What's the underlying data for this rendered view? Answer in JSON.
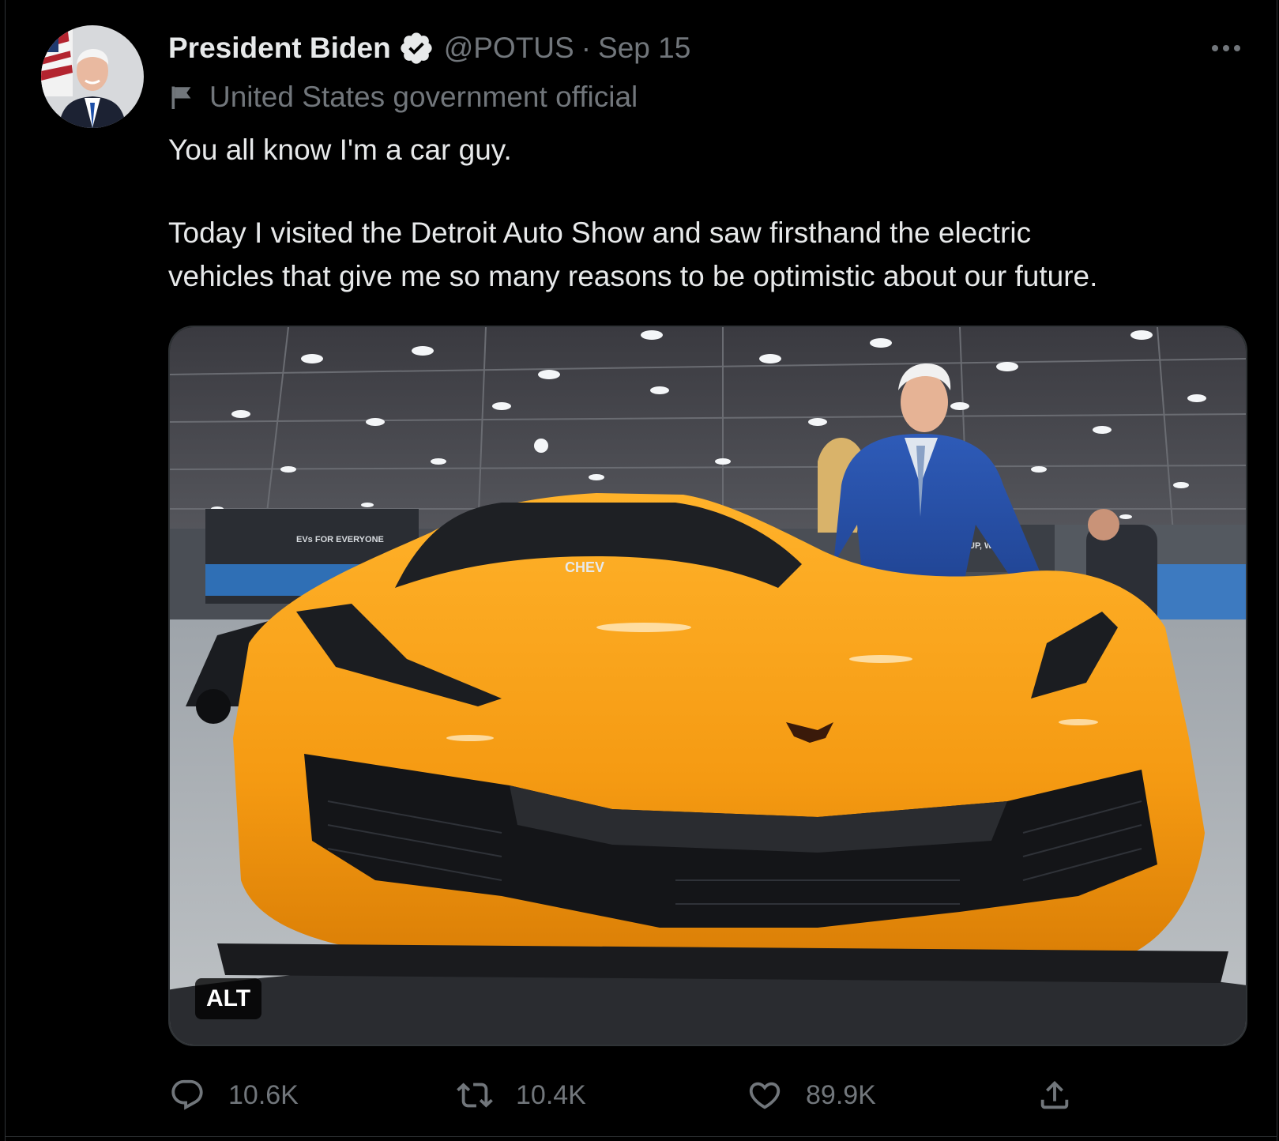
{
  "tweet": {
    "author": {
      "display_name": "President Biden",
      "handle": "@POTUS",
      "verified": true,
      "avatar_icon": "avatar-photo"
    },
    "separator": "·",
    "date": "Sep 15",
    "label": "United States government official",
    "text": {
      "line1": "You all know I'm a car guy.",
      "line2": "Today I visited the Detroit Auto Show and saw firsthand the electric",
      "line3": "vehicles that give me so many reasons to be optimistic about our future."
    },
    "media": {
      "alt_badge": "ALT",
      "booth_sign": "EVs FOR EVERYONE",
      "car_badge": "CHEV",
      "side_sign": "N UP, WORLD"
    },
    "stats": {
      "replies": "10.6K",
      "retweets": "10.4K",
      "likes": "89.9K"
    }
  },
  "colors": {
    "background": "#000000",
    "text_primary": "#e7e9ea",
    "text_secondary": "#71767b",
    "border": "#2f3336",
    "car_orange": "#f59a12"
  }
}
